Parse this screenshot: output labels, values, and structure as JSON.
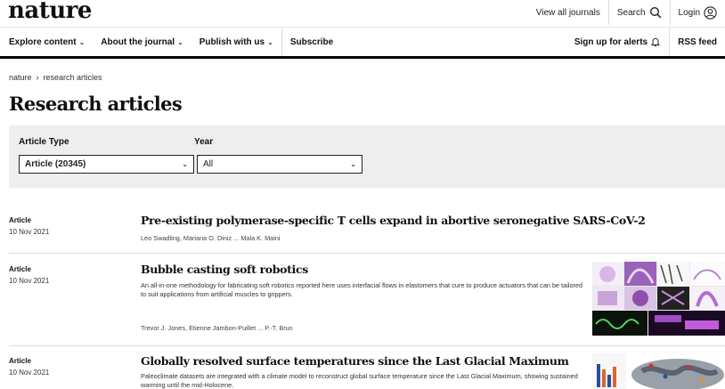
{
  "header": {
    "logo": "nature",
    "view_all_journals": "View all journals",
    "search_label": "Search",
    "login_label": "Login"
  },
  "nav": {
    "items": [
      "Explore content",
      "About the journal",
      "Publish with us"
    ],
    "subscribe": "Subscribe",
    "alerts": "Sign up for alerts",
    "rss": "RSS feed"
  },
  "breadcrumb": {
    "root": "nature",
    "current": "research articles"
  },
  "page_title": "Research articles",
  "filters": {
    "article_type_label": "Article Type",
    "article_type_value": "Article (20345)",
    "year_label": "Year",
    "year_value": "All"
  },
  "articles": [
    {
      "type": "Article",
      "date": "10 Nov 2021",
      "title": "Pre-existing polymerase-specific T cells expand in abortive seronegative SARS-CoV-2",
      "description": "",
      "authors": "Leo Swadling, Mariana O. Diniz ... Mala K. Maini"
    },
    {
      "type": "Article",
      "date": "10 Nov 2021",
      "title": "Bubble casting soft robotics",
      "description": "An all-in-one methodology for fabricating soft robotics reported here uses interfacial flows in elastomers that cure to produce actuators that can be tailored to suit applications from artificial muscles to grippers.",
      "authors": "Trevor J. Jones, Etienne Jambon-Puillet ... P.-T. Brun"
    },
    {
      "type": "Article",
      "date": "10 Nov 2021",
      "title": "Globally resolved surface temperatures since the Last Glacial Maximum",
      "description": "Paleoclimate datasets are integrated with a climate model to reconstruct global surface temperature since the Last Glacial Maximum, showing sustained warming until the mid-Holocene.",
      "authors": ""
    }
  ],
  "colors": {
    "accent_border": "#000000",
    "filter_bg": "#eeeeee"
  }
}
